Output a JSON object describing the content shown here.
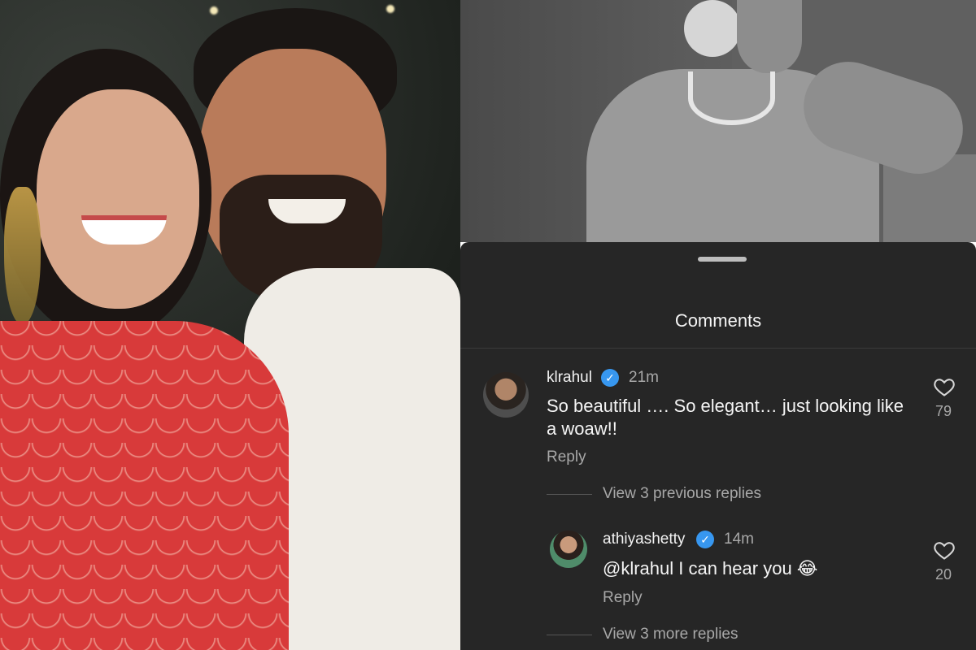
{
  "sheet": {
    "title": "Comments"
  },
  "comments": [
    {
      "username": "klrahul",
      "verified_icon": "verified-badge-icon",
      "time": "21m",
      "text_line1": "So beautiful …. So elegant… just looking like",
      "text_line2": "a woaw!!",
      "reply_label": "Reply",
      "likes": "79",
      "view_replies": "View 3 previous replies"
    },
    {
      "username": "athiyashetty",
      "verified_icon": "verified-badge-icon",
      "time": "14m",
      "text": "@klrahul I can hear you 😂",
      "reply_label": "Reply",
      "likes": "20",
      "view_replies": "View 3 more replies"
    }
  ],
  "colors": {
    "sheet_bg": "#262626",
    "verified": "#3797f0",
    "muted_text": "#a8a8a8"
  }
}
